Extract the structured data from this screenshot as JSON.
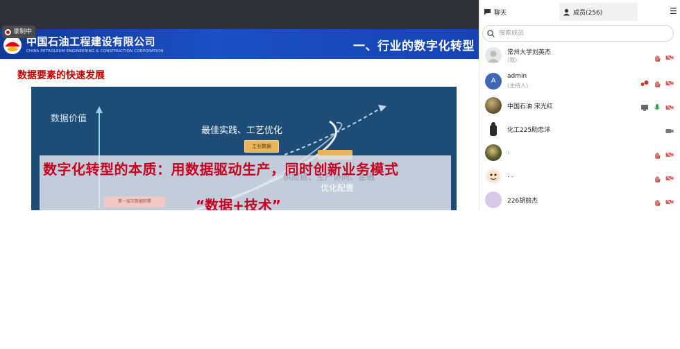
{
  "recording": {
    "label": "录制中"
  },
  "slide": {
    "company_cn": "中国石油工程建设有限公司",
    "company_en": "CHINA PETROLEUM ENGINEERING & CONSTRUCTION CORPORATION",
    "section_title": "一、行业的数字化转型",
    "subtitle": "数据要素的快速发展",
    "y_axis_label": "数据价值",
    "best_practice": "最佳实践、工艺优化",
    "tag_industrial": "工业数据",
    "tag_left": "第一层次数据积累",
    "overlay_main": "数字化转型的本质：用数据驱动生产，同时创新业务模式",
    "overlay_faint": "供应链、生产协同、金融",
    "overlay_optimize": "优化配置",
    "overlay_data_tech": "“数据+技术”",
    "colors": {
      "header_blue": "#1b4fc4",
      "diagram_bg": "#1d4c77",
      "accent_red": "#c8001e",
      "tag_gold": "#e9b45a"
    }
  },
  "panel": {
    "tab_chat": "聊天",
    "tab_members": "成员(256)",
    "search_placeholder": "搜索成员",
    "members": [
      {
        "name": "常州大学刘英杰",
        "role": "(我)",
        "avatar": "gray-person",
        "icons": [
          "hand-icon",
          "camera-off-icon"
        ]
      },
      {
        "name": "admin",
        "role": "(主持人)",
        "avatar": "letter-A",
        "avatar_letter": "A",
        "icons": [
          "share-icon",
          "hand-icon",
          "camera-off-icon"
        ]
      },
      {
        "name": "中国石油 宋光红",
        "role": "",
        "avatar": "photo",
        "icons": [
          "screen-icon",
          "mic-icon",
          "camera-off-icon"
        ]
      },
      {
        "name": "化工225助忠洋",
        "role": "",
        "avatar": "photo-dark",
        "icons": [
          "camera-icon"
        ]
      },
      {
        "name": ".",
        "role": "",
        "avatar": "photo",
        "icons": [
          "hand-icon",
          "camera-off-icon"
        ]
      },
      {
        "name": ". .",
        "role": "",
        "avatar": "cartoon",
        "icons": [
          "hand-icon",
          "camera-off-icon"
        ]
      },
      {
        "name": "226胡丽杰",
        "role": "",
        "avatar": "lavender",
        "icons": [
          "hand-icon",
          "camera-off-icon"
        ]
      }
    ]
  }
}
